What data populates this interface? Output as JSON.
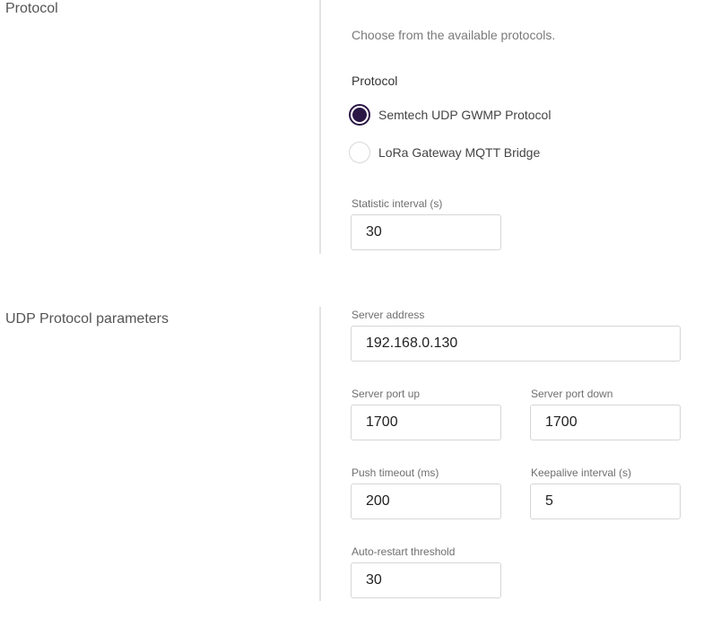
{
  "protocol_section": {
    "title": "Protocol",
    "description": "Choose from the available protocols.",
    "group_label": "Protocol",
    "options": [
      {
        "label": "Semtech UDP GWMP Protocol",
        "selected": true
      },
      {
        "label": "LoRa Gateway MQTT Bridge",
        "selected": false
      }
    ],
    "statistic_interval": {
      "label": "Statistic interval (s)",
      "value": "30"
    }
  },
  "udp_section": {
    "title": "UDP Protocol parameters",
    "server_address": {
      "label": "Server address",
      "value": "192.168.0.130"
    },
    "server_port_up": {
      "label": "Server port up",
      "value": "1700"
    },
    "server_port_down": {
      "label": "Server port down",
      "value": "1700"
    },
    "push_timeout": {
      "label": "Push timeout (ms)",
      "value": "200"
    },
    "keepalive_interval": {
      "label": "Keepalive interval (s)",
      "value": "5"
    },
    "auto_restart_threshold": {
      "label": "Auto-restart threshold",
      "value": "30"
    }
  },
  "colors": {
    "radio_selected": "#2b1646",
    "divider": "#e3e3e3",
    "input_border": "#d6d6d6"
  }
}
